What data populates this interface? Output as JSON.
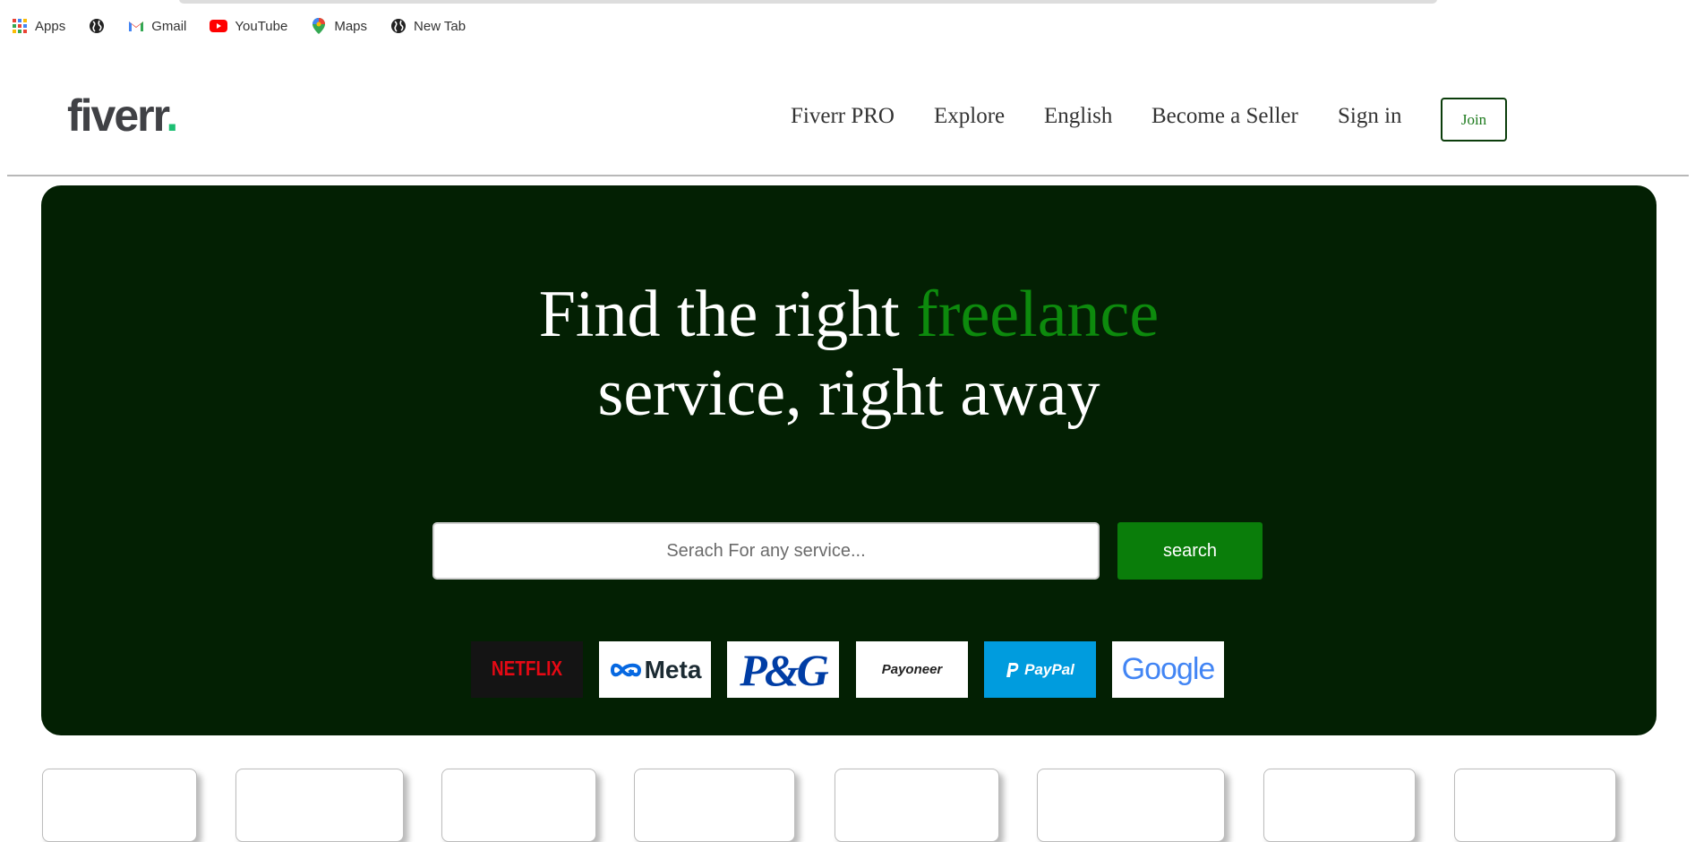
{
  "bookmarks": {
    "apps": {
      "label": "Apps",
      "icon": "apps-grid-icon"
    },
    "globe": {
      "icon": "globe-icon"
    },
    "gmail": {
      "label": "Gmail",
      "icon": "gmail-icon"
    },
    "youtube": {
      "label": "YouTube",
      "icon": "youtube-icon"
    },
    "maps": {
      "label": "Maps",
      "icon": "maps-pin-icon"
    },
    "newtab": {
      "label": "New Tab",
      "icon": "globe-icon"
    }
  },
  "header": {
    "logo_text": "fiverr",
    "logo_dot": ".",
    "nav": {
      "pro": "Fiverr PRO",
      "explore": "Explore",
      "english": "English",
      "seller": "Become a Seller",
      "signin": "Sign in"
    },
    "join_label": "Join"
  },
  "hero": {
    "headline_part1": "Find the right ",
    "headline_accent": "freelance",
    "headline_part2": "service, right away",
    "search_placeholder": "Serach For any service...",
    "search_button": "search",
    "brands": {
      "netflix": "NETFLIX",
      "meta": "Meta",
      "pg": "P&G",
      "payoneer": "Payoneer",
      "paypal": "PayPal",
      "google": "Google"
    }
  },
  "colors": {
    "hero_bg": "#032003",
    "accent_green": "#0d8a0d",
    "search_button_bg": "#0a7d0a",
    "fiverr_dot": "#1dbf73"
  }
}
